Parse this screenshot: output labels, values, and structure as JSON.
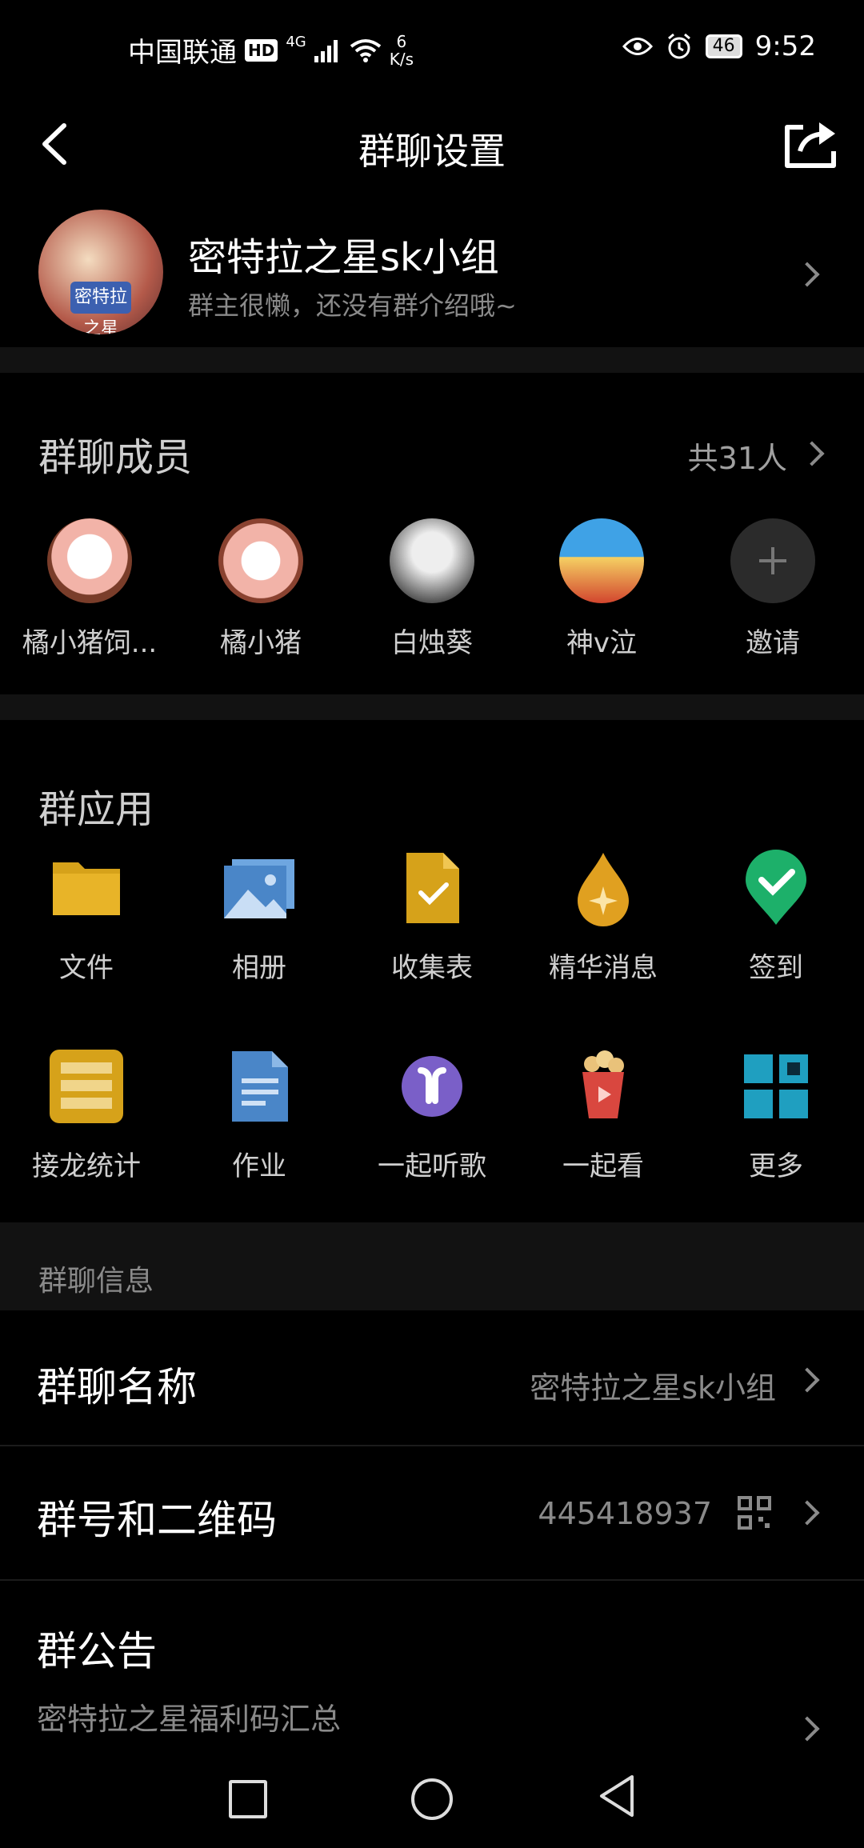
{
  "status_bar": {
    "carrier": "中国联通",
    "hd": "HD",
    "network": "4G",
    "speed_value": "6",
    "speed_unit": "K/s",
    "battery": "46",
    "time": "9:52"
  },
  "header": {
    "title": "群聊设置"
  },
  "group": {
    "name": "密特拉之星sk小组",
    "intro": "群主很懒，还没有群介绍哦~",
    "avatar_badge": "密特拉之星"
  },
  "members": {
    "title": "群聊成员",
    "count": "共31人",
    "list": [
      {
        "name": "橘小猪饲..."
      },
      {
        "name": "橘小猪"
      },
      {
        "name": "白烛葵"
      },
      {
        "name": "神v泣"
      },
      {
        "name": "邀请"
      }
    ]
  },
  "apps": {
    "title": "群应用",
    "list": [
      {
        "label": "文件",
        "icon": "folder-icon"
      },
      {
        "label": "相册",
        "icon": "photo-album-icon"
      },
      {
        "label": "收集表",
        "icon": "form-check-icon"
      },
      {
        "label": "精华消息",
        "icon": "essence-drop-icon"
      },
      {
        "label": "签到",
        "icon": "check-in-pin-icon"
      },
      {
        "label": "接龙统计",
        "icon": "relay-list-icon"
      },
      {
        "label": "作业",
        "icon": "homework-doc-icon"
      },
      {
        "label": "一起听歌",
        "icon": "earbuds-icon"
      },
      {
        "label": "一起看",
        "icon": "popcorn-play-icon"
      },
      {
        "label": "更多",
        "icon": "grid-more-icon"
      }
    ]
  },
  "info": {
    "section_title": "群聊信息",
    "name_label": "群聊名称",
    "name_value": "密特拉之星sk小组",
    "number_label": "群号和二维码",
    "number_value": "445418937",
    "notice_label": "群公告",
    "notice_preview": "密特拉之星福利码汇总"
  },
  "colors": {
    "background": "#000000",
    "secondary_text": "#8a8a8a",
    "folder": "#d6a21a",
    "album": "#4a86c8",
    "form": "#d6a21a",
    "essence": "#e0a020",
    "check_in": "#1db06a",
    "relay": "#d6a21a",
    "homework": "#4a86c8",
    "music": "#7a5fc8",
    "watch": "#d9473f",
    "more": "#1f9fc0"
  }
}
